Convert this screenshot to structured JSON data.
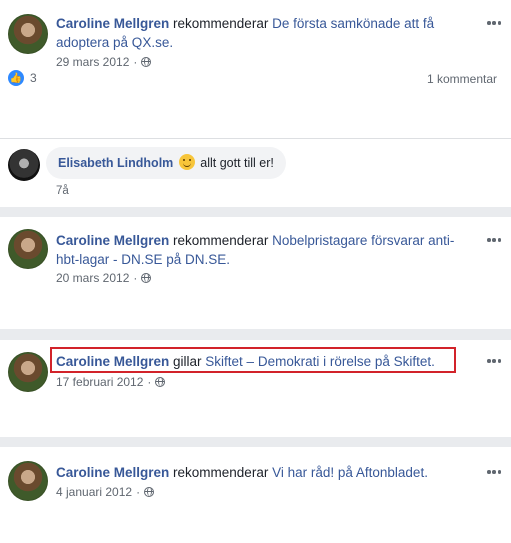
{
  "posts": [
    {
      "author": "Caroline Mellgren",
      "action": " rekommenderar ",
      "link": "De första samkönade att få adoptera på QX.se.",
      "date": "29 mars 2012",
      "likes": "3",
      "comments": "1 kommentar"
    },
    {
      "author": "Caroline Mellgren",
      "action": " rekommenderar ",
      "link": "Nobelpristagare försvarar anti-hbt-lagar - DN.SE på DN.SE.",
      "date": "20 mars 2012"
    },
    {
      "author": "Caroline Mellgren",
      "action": " gillar ",
      "link": "Skiftet – Demokrati i rörelse på Skiftet.",
      "date": "17 februari 2012"
    },
    {
      "author": "Caroline Mellgren",
      "action": " rekommenderar ",
      "link": "Vi har råd! på Aftonbladet.",
      "date": "4 januari 2012"
    }
  ],
  "comment": {
    "author": "Elisabeth Lindholm",
    "text": " allt gott till er!",
    "age": "7å"
  },
  "icons": {
    "privacy": "globe-icon",
    "menu": "more-options-icon",
    "like": "thumbs-up-icon",
    "emoji": "smiley-icon"
  },
  "colors": {
    "name": "#385898",
    "highlight": "#d2232a",
    "like": "#2e89ff"
  }
}
